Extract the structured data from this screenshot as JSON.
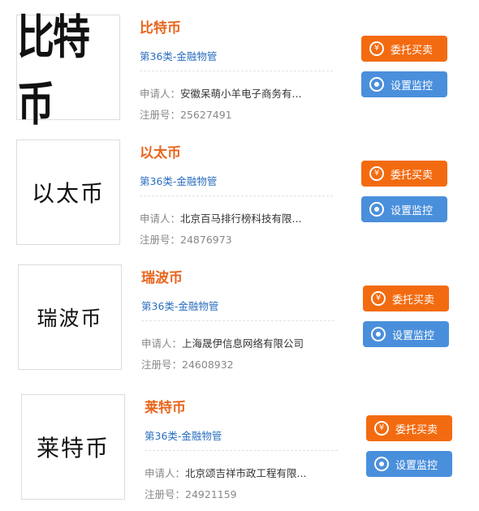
{
  "labels": {
    "applicant": "申请人：",
    "reg_no": "注册号：",
    "trade_button": "委托买卖",
    "monitor_button": "设置监控",
    "yen_icon": "¥"
  },
  "trademarks": [
    {
      "logo_text": "比特币",
      "name": "比特币",
      "class": "第36类-金融物管",
      "applicant": "安徽呆萌小羊电子商务有...",
      "reg_no": "25627491"
    },
    {
      "logo_text": "以太币",
      "name": "以太币",
      "class": "第36类-金融物管",
      "applicant": "北京百马排行榜科技有限...",
      "reg_no": "24876973"
    },
    {
      "logo_text": "瑞波币",
      "name": "瑞波币",
      "class": "第36类-金融物管",
      "applicant": "上海晟伊信息网络有限公司",
      "reg_no": "24608932"
    },
    {
      "logo_text": "莱特币",
      "name": "莱特币",
      "class": "第36类-金融物管",
      "applicant": "北京颂吉祥市政工程有限...",
      "reg_no": "24921159"
    }
  ],
  "colors": {
    "name": "#e8641b",
    "class_link": "#2b6fbf",
    "trade_button": "#f36b10",
    "monitor_button": "#4a8fdc"
  }
}
